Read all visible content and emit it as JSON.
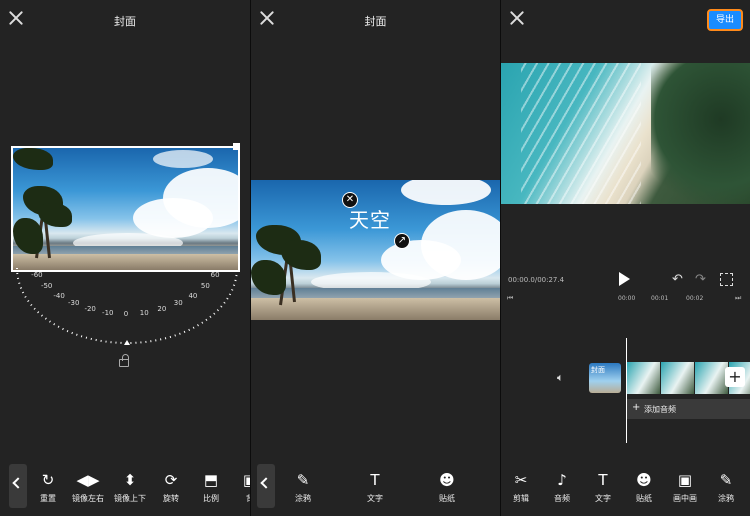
{
  "panel_cover": {
    "title": "封面",
    "dial_labels": [
      "-60",
      "-50",
      "-40",
      "-30",
      "-20",
      "-10",
      "0",
      "10",
      "20",
      "30",
      "40",
      "50",
      "60"
    ],
    "tools": [
      {
        "label": "重置",
        "icon": "rotate-reset-icon",
        "glyph": "↻"
      },
      {
        "label": "镜像左右",
        "icon": "mirror-horizontal-icon",
        "glyph": "◀▶"
      },
      {
        "label": "镜像上下",
        "icon": "mirror-vertical-icon",
        "glyph": "⬍"
      },
      {
        "label": "旋转",
        "icon": "rotate-icon",
        "glyph": "⟳"
      },
      {
        "label": "比例",
        "icon": "aspect-ratio-icon",
        "glyph": "⬒"
      },
      {
        "label": "背",
        "icon": "crop-icon",
        "glyph": "▣"
      }
    ]
  },
  "panel_text": {
    "title": "封面",
    "overlay_text": "天空",
    "tools": [
      {
        "label": "涂鸦",
        "icon": "brush-icon",
        "glyph": "✎"
      },
      {
        "label": "文字",
        "icon": "text-icon",
        "glyph": "T"
      },
      {
        "label": "贴纸",
        "icon": "sticker-icon",
        "glyph": "☻"
      }
    ]
  },
  "panel_editor": {
    "export_label": "导出",
    "current_time": "00:00.0/00:27.4",
    "ruler": [
      "00:00",
      "00:01",
      "00:02"
    ],
    "cover_label": "封面",
    "add_audio_label": "添加音频",
    "tools": [
      {
        "label": "剪辑",
        "icon": "scissors-icon",
        "glyph": "✂"
      },
      {
        "label": "音频",
        "icon": "music-note-icon",
        "glyph": "♪"
      },
      {
        "label": "文字",
        "icon": "text-icon",
        "glyph": "T"
      },
      {
        "label": "贴纸",
        "icon": "sticker-icon",
        "glyph": "☻"
      },
      {
        "label": "画中画",
        "icon": "picture-in-picture-icon",
        "glyph": "▣"
      },
      {
        "label": "涂鸦",
        "icon": "brush-icon",
        "glyph": "✎"
      }
    ]
  }
}
